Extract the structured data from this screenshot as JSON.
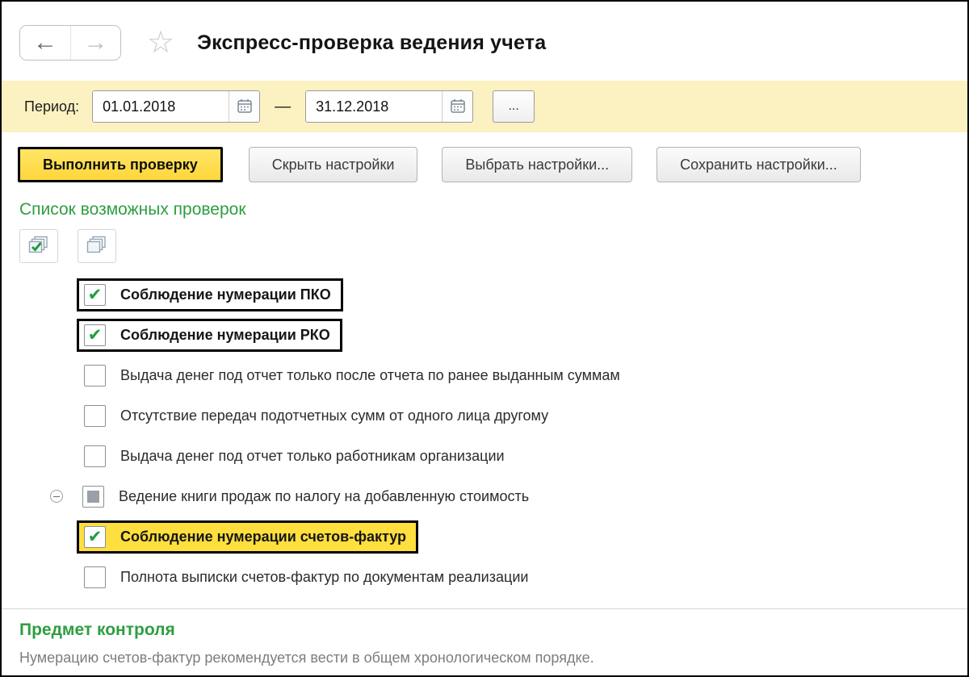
{
  "window": {
    "title": "Экспресс-проверка ведения учета"
  },
  "icons": {
    "back_arrow": "←",
    "forward_arrow": "→",
    "favorite_star": "☆"
  },
  "period_bar": {
    "label": "Период:",
    "date_from": "01.01.2018",
    "date_to": "31.12.2018",
    "separator": "—",
    "more_button_label": "..."
  },
  "action_buttons": {
    "run_check": "Выполнить проверку",
    "hide_settings": "Скрыть настройки",
    "select_settings": "Выбрать настройки...",
    "save_settings": "Сохранить настройки..."
  },
  "checks_section": {
    "title": "Список возможных проверок",
    "toolbar": {
      "check_all_hint": "check-all",
      "uncheck_all_hint": "uncheck-all"
    },
    "items": [
      {
        "label": "Соблюдение нумерации ПКО",
        "state": "checked",
        "highlighted": true,
        "bold": true
      },
      {
        "label": "Соблюдение нумерации РКО",
        "state": "checked",
        "highlighted": true,
        "bold": true
      },
      {
        "label": "Выдача денег под отчет только после отчета по ранее выданным суммам",
        "state": "unchecked"
      },
      {
        "label": "Отсутствие передач подотчетных сумм от одного лица другому",
        "state": "unchecked"
      },
      {
        "label": "Выдача денег под отчет только работникам организации",
        "state": "unchecked"
      },
      {
        "label": "Ведение книги продаж по налогу на добавленную стоимость",
        "state": "partial",
        "tree_node": true,
        "expanded": true
      },
      {
        "label": "Соблюдение нумерации счетов-фактур",
        "state": "checked",
        "highlighted": true,
        "selected": true,
        "bold": true
      },
      {
        "label": "Полнота выписки счетов-фактур по документам реализации",
        "state": "unchecked"
      }
    ]
  },
  "subject_section": {
    "title": "Предмет контроля",
    "text": "Нумерацию счетов-фактур рекомендуется вести в общем хронологическом порядке."
  },
  "colors": {
    "accent_yellow": "#fcf2c1",
    "button_yellow": "#ffd63c",
    "selected_yellow": "#ffdf3e",
    "green": "#2e9e41",
    "check_green": "#1f9e3e"
  }
}
